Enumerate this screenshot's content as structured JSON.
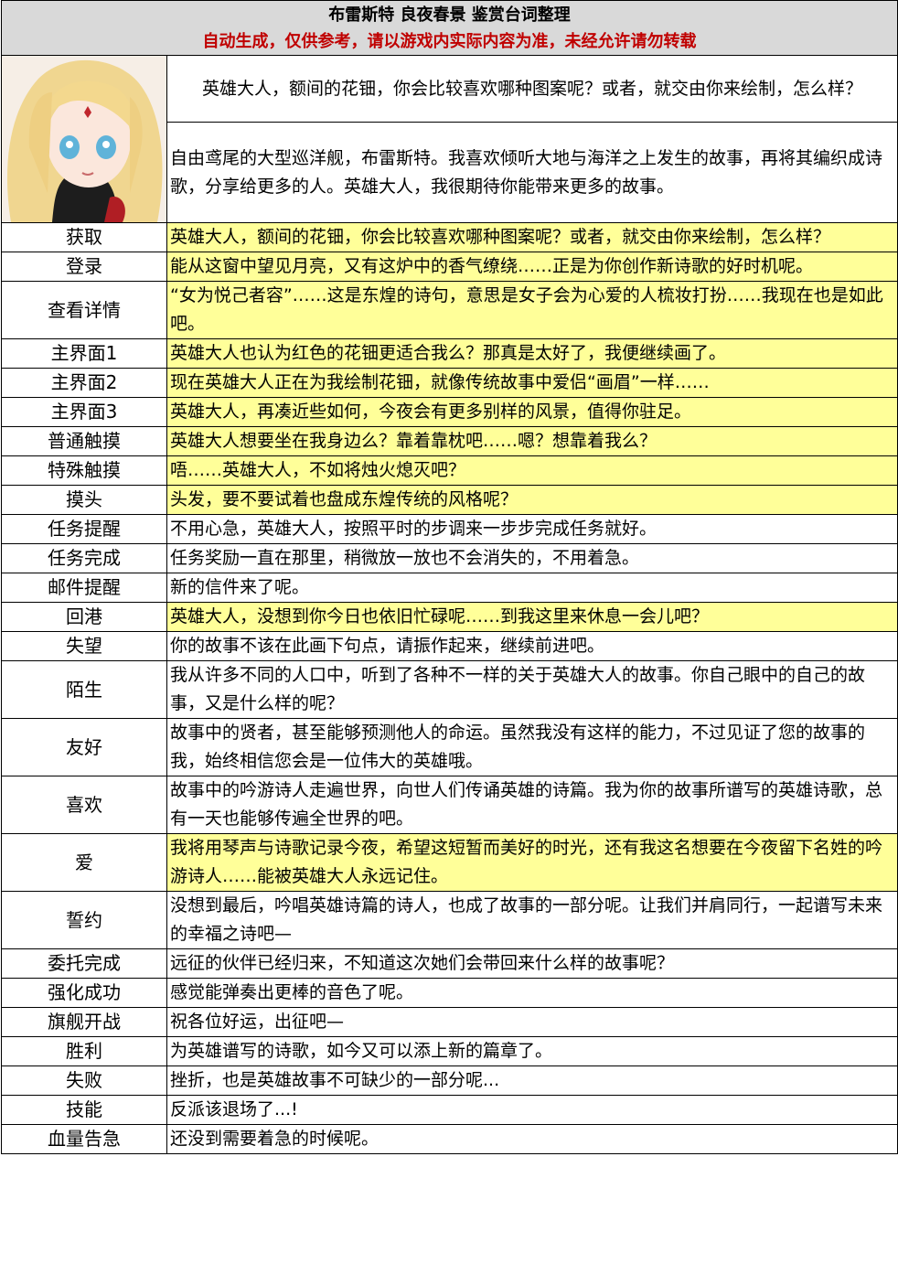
{
  "header": {
    "title": "布雷斯特  良夜春景  鉴赏台词整理",
    "subtitle": "自动生成，仅供参考，请以游戏内实际内容为准，未经允许请勿转载"
  },
  "intro": {
    "line1": "英雄大人，额间的花钿，你会比较喜欢哪种图案呢？或者，就交由你来绘制，怎么样？",
    "line2": "自由鸢尾的大型巡洋舰，布雷斯特。我喜欢倾听大地与海洋之上发生的故事，再将其编织成诗歌，分享给更多的人。英雄大人，我很期待你能带来更多的故事。"
  },
  "rows": [
    {
      "label": "获取",
      "text": "英雄大人，额间的花钿，你会比较喜欢哪种图案呢？或者，就交由你来绘制，怎么样？",
      "highlight": true
    },
    {
      "label": "登录",
      "text": "能从这窗中望见月亮，又有这炉中的香气缭绕……正是为你创作新诗歌的好时机呢。",
      "highlight": true
    },
    {
      "label": "查看详情",
      "text": "“女为悦己者容”……这是东煌的诗句，意思是女子会为心爱的人梳妆打扮……我现在也是如此吧。",
      "highlight": true
    },
    {
      "label": "主界面1",
      "text": "英雄大人也认为红色的花钿更适合我么？那真是太好了，我便继续画了。",
      "highlight": true
    },
    {
      "label": "主界面2",
      "text": "现在英雄大人正在为我绘制花钿，就像传统故事中爱侣“画眉”一样……",
      "highlight": true
    },
    {
      "label": "主界面3",
      "text": "英雄大人，再凑近些如何，今夜会有更多别样的风景，值得你驻足。",
      "highlight": true
    },
    {
      "label": "普通触摸",
      "text": "英雄大人想要坐在我身边么？靠着靠枕吧……嗯？想靠着我么？",
      "highlight": true
    },
    {
      "label": "特殊触摸",
      "text": "唔……英雄大人，不如将烛火熄灭吧？",
      "highlight": true
    },
    {
      "label": "摸头",
      "text": "头发，要不要试着也盘成东煌传统的风格呢？",
      "highlight": true
    },
    {
      "label": "任务提醒",
      "text": "不用心急，英雄大人，按照平时的步调来一步步完成任务就好。",
      "highlight": false
    },
    {
      "label": "任务完成",
      "text": "任务奖励一直在那里，稍微放一放也不会消失的，不用着急。",
      "highlight": false
    },
    {
      "label": "邮件提醒",
      "text": "新的信件来了呢。",
      "highlight": false
    },
    {
      "label": "回港",
      "text": "英雄大人，没想到你今日也依旧忙碌呢……到我这里来休息一会儿吧？",
      "highlight": true
    },
    {
      "label": "失望",
      "text": "你的故事不该在此画下句点，请振作起来，继续前进吧。",
      "highlight": false
    },
    {
      "label": "陌生",
      "text": "我从许多不同的人口中，听到了各种不一样的关于英雄大人的故事。你自己眼中的自己的故事，又是什么样的呢？",
      "highlight": false
    },
    {
      "label": "友好",
      "text": "故事中的贤者，甚至能够预测他人的命运。虽然我没有这样的能力，不过见证了您的故事的我，始终相信您会是一位伟大的英雄哦。",
      "highlight": false
    },
    {
      "label": "喜欢",
      "text": "故事中的吟游诗人走遍世界，向世人们传诵英雄的诗篇。我为你的故事所谱写的英雄诗歌，总有一天也能够传遍全世界的吧。",
      "highlight": false
    },
    {
      "label": "爱",
      "text": "我将用琴声与诗歌记录今夜，希望这短暂而美好的时光，还有我这名想要在今夜留下名姓的吟游诗人……能被英雄大人永远记住。",
      "highlight": true
    },
    {
      "label": "誓约",
      "text": "没想到最后，吟唱英雄诗篇的诗人，也成了故事的一部分呢。让我们并肩同行，一起谱写未来的幸福之诗吧—",
      "highlight": false
    },
    {
      "label": "委托完成",
      "text": "远征的伙伴已经归来，不知道这次她们会带回来什么样的故事呢？",
      "highlight": false
    },
    {
      "label": "强化成功",
      "text": "感觉能弹奏出更棒的音色了呢。",
      "highlight": false
    },
    {
      "label": "旗舰开战",
      "text": "祝各位好运，出征吧—",
      "highlight": false
    },
    {
      "label": "胜利",
      "text": "为英雄谱写的诗歌，如今又可以添上新的篇章了。",
      "highlight": false
    },
    {
      "label": "失败",
      "text": "挫折，也是英雄故事不可缺少的一部分呢...",
      "highlight": false
    },
    {
      "label": "技能",
      "text": "反派该退场了...!",
      "highlight": false
    },
    {
      "label": "血量告急",
      "text": "还没到需要着急的时候呢。",
      "highlight": false
    }
  ],
  "colors": {
    "header_bg": "#d9d9d9",
    "subtitle": "#c00000",
    "highlight": "#ffff99",
    "border": "#000000"
  }
}
